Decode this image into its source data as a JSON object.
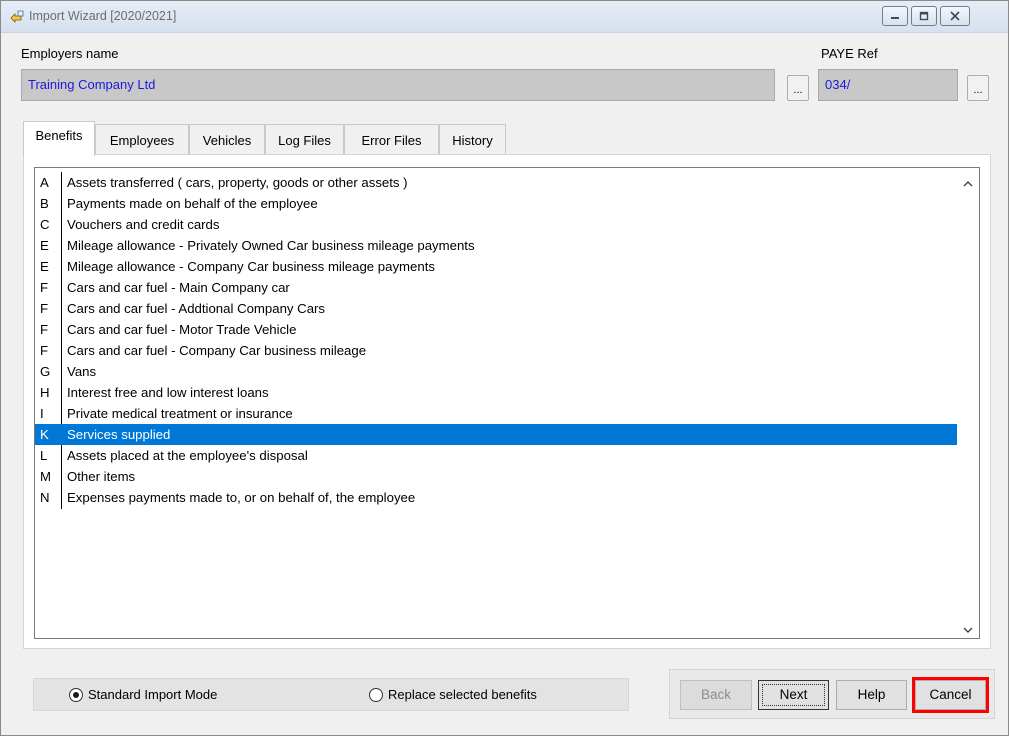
{
  "window": {
    "title": "Import Wizard [2020/2021]",
    "controls": [
      "minimize",
      "maximize",
      "close"
    ]
  },
  "header": {
    "employer_label": "Employers name",
    "employer_value": "Training Company Ltd",
    "employer_browse": "...",
    "paye_label": "PAYE Ref",
    "paye_value": "034/",
    "paye_browse": "..."
  },
  "tabs": [
    {
      "label": "Benefits",
      "active": true
    },
    {
      "label": "Employees",
      "active": false
    },
    {
      "label": "Vehicles",
      "active": false
    },
    {
      "label": "Log Files",
      "active": false
    },
    {
      "label": "Error Files",
      "active": false
    },
    {
      "label": "History",
      "active": false
    }
  ],
  "benefits": [
    {
      "code": "A",
      "desc": "Assets transferred ( cars, property, goods or other assets )"
    },
    {
      "code": "B",
      "desc": "Payments made on behalf of the employee"
    },
    {
      "code": "C",
      "desc": "Vouchers and credit cards"
    },
    {
      "code": "E",
      "desc": "Mileage allowance - Privately Owned Car business mileage payments"
    },
    {
      "code": "E",
      "desc": "Mileage allowance - Company Car business mileage payments"
    },
    {
      "code": "F",
      "desc": "Cars and car fuel - Main Company car"
    },
    {
      "code": "F",
      "desc": "Cars and car fuel - Addtional Company Cars"
    },
    {
      "code": "F",
      "desc": "Cars and car fuel - Motor Trade Vehicle"
    },
    {
      "code": "F",
      "desc": "Cars and car fuel - Company Car business mileage"
    },
    {
      "code": "G",
      "desc": "Vans"
    },
    {
      "code": "H",
      "desc": "Interest free and low interest loans"
    },
    {
      "code": "I",
      "desc": "Private medical treatment or insurance"
    },
    {
      "code": "K",
      "desc": "Services supplied",
      "selected": true
    },
    {
      "code": "L",
      "desc": "Assets placed at the employee's disposal"
    },
    {
      "code": "M",
      "desc": "Other items"
    },
    {
      "code": "N",
      "desc": "Expenses payments made to, or on behalf of, the employee"
    }
  ],
  "mode": {
    "standard_label": "Standard Import Mode",
    "replace_label": "Replace selected benefits",
    "selected": "standard"
  },
  "buttons": {
    "back": "Back",
    "next": "Next",
    "help": "Help",
    "cancel": "Cancel"
  },
  "colors": {
    "selection": "#0078d7",
    "field_text": "#1a1adb",
    "highlight_outline": "#ff0000"
  }
}
